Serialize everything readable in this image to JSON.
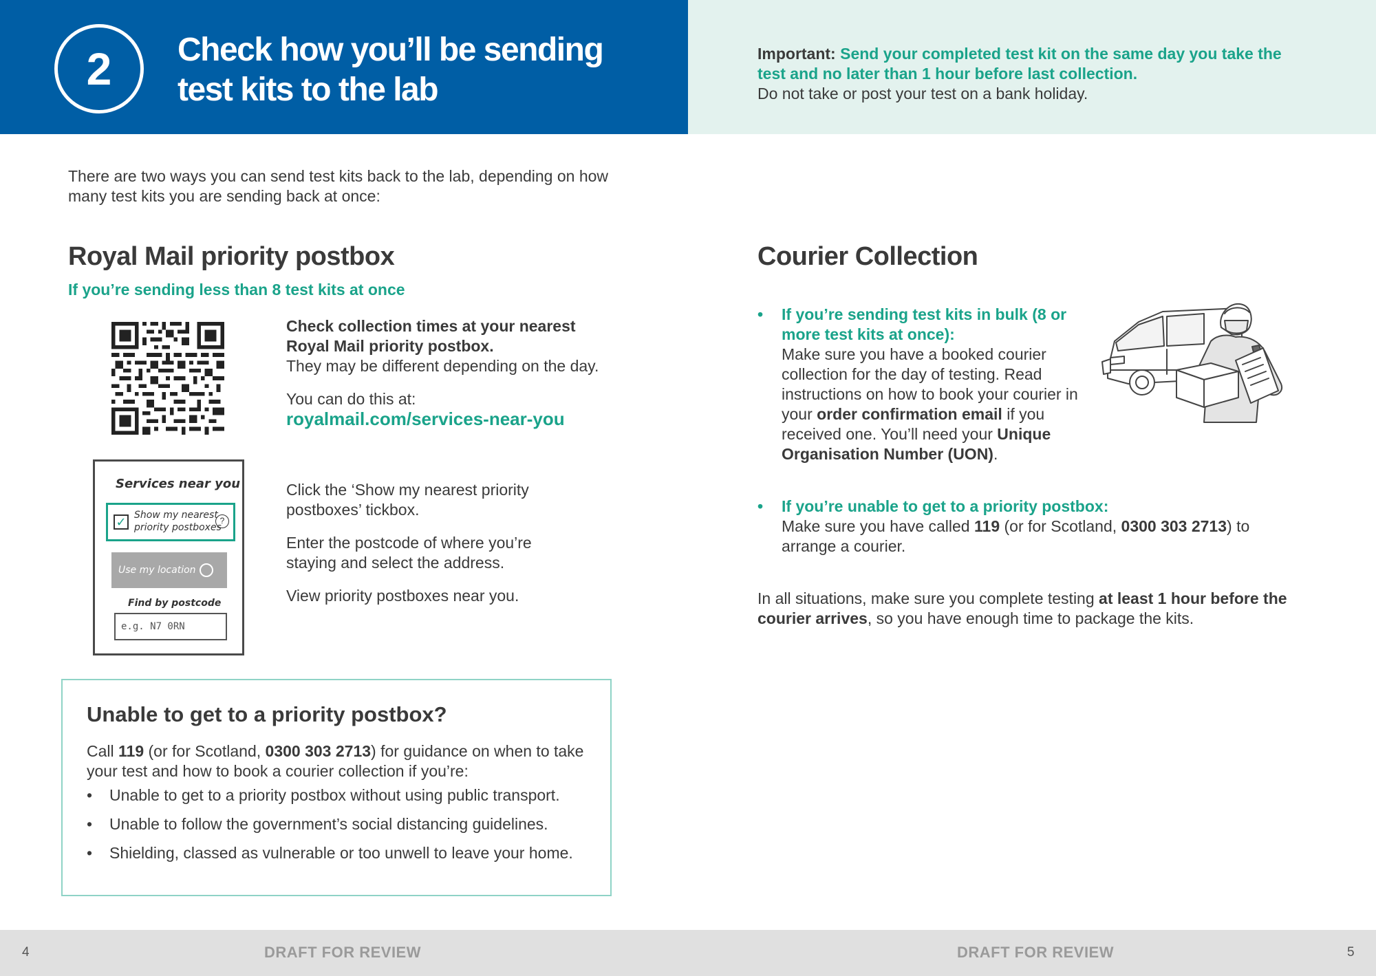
{
  "header": {
    "step_number": "2",
    "title_line1": "Check how you’ll be sending",
    "title_line2": "test kits to the lab"
  },
  "important": {
    "label": "Important:",
    "highlight_line1": "Send your completed test kit on the same day you take the",
    "highlight_line2": "test and no later than 1 hour before last collection.",
    "note": "Do not take or post your test on a bank holiday."
  },
  "intro": {
    "line1": "There are two ways you can send test kits back to the lab, depending on how",
    "line2": "many test kits you are sending back at once:"
  },
  "royal_mail": {
    "heading": "Royal Mail priority postbox",
    "subheading": "If you’re sending less than 8 test kits at once",
    "check_bold_1": "Check collection times at your nearest",
    "check_bold_2": "Royal Mail priority postbox.",
    "check_text": "They may be different depending on the day.",
    "do_this_at": "You can do this at:",
    "link": "royalmail.com/services-near-you",
    "steps": [
      {
        "line1": "Click the ‘Show my nearest priority",
        "line2": "postboxes’ tickbox."
      },
      {
        "line1": "Enter the postcode of where you’re",
        "line2": "staying and select the address."
      },
      {
        "line1": "View priority postboxes near you.",
        "line2": ""
      }
    ],
    "phone": {
      "title": "Services near you",
      "checkbox_line1": "Show my nearest",
      "checkbox_line2": "priority postboxes",
      "help": "?",
      "use_location": "Use my location",
      "find_by_postcode": "Find by postcode",
      "postcode_placeholder": "e.g. N7 0RN"
    }
  },
  "callout": {
    "heading": "Unable to get to a priority postbox?",
    "para_pre": "Call ",
    "para_num1": "119",
    "para_mid": " (or for Scotland, ",
    "para_num2": "0300 303 2713",
    "para_post1": ") for guidance on when to take",
    "para_line2": "your test and how to book a courier collection if you’re:",
    "bullets": [
      "Unable to get to a priority postbox without using public transport.",
      "Unable to follow the government’s social distancing guidelines.",
      "Shielding, classed as vulnerable or too unwell to leave your home."
    ]
  },
  "courier": {
    "heading": "Courier Collection",
    "item1_heading_1": "If you’re sending test kits in bulk (8 or",
    "item1_heading_2": "more test kits at once):",
    "item1_l1": "Make sure you have a booked courier",
    "item1_l2": "collection for the day of testing. Read",
    "item1_l3": "instructions on how to book your courier in",
    "item1_l4_pre": "your ",
    "item1_l4_bold": "order confirmation email",
    "item1_l4_post": " if you",
    "item1_l5_pre": "received one. You’ll need your ",
    "item1_l5_bold": "Unique",
    "item1_l6_bold": "Organisation Number (UON)",
    "item1_l6_post": ".",
    "item2_heading": "If you’re unable to get to a priority postbox:",
    "item2_pre": "Make sure you have called ",
    "item2_num1": "119",
    "item2_mid": " (or for Scotland, ",
    "item2_num2": "0300 303 2713",
    "item2_post": ") to",
    "item2_line2": "arrange a courier.",
    "all_pre": "In all situations, make sure you complete testing ",
    "all_bold1": "at least 1 hour before the",
    "all_bold2": "courier arrives",
    "all_post": ", so you have enough time to package the kits."
  },
  "footer": {
    "page_left": "4",
    "page_right": "5",
    "draft_left": "DRAFT FOR REVIEW",
    "draft_right": "DRAFT FOR REVIEW"
  },
  "colors": {
    "header_blue": "#005ea5",
    "accent_green": "#1aa38a",
    "mint_bg": "#e3f2ee",
    "footer_grey": "#e0e0e0"
  }
}
